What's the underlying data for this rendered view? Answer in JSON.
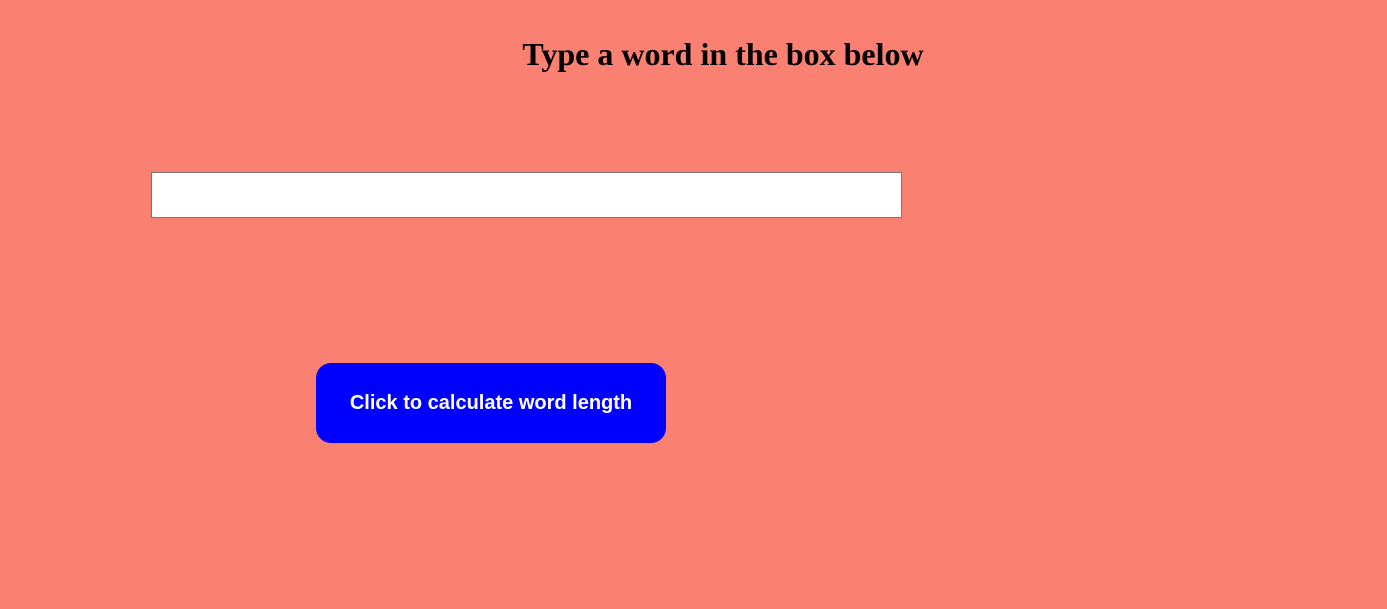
{
  "page": {
    "background_color": "#FA8072"
  },
  "heading": {
    "text": "Type a word in the box below"
  },
  "word_input": {
    "value": "",
    "placeholder": ""
  },
  "calculate_button": {
    "label": "Click to calculate word length",
    "background_color": "#0000FF",
    "text_color": "#FFFFFF"
  }
}
